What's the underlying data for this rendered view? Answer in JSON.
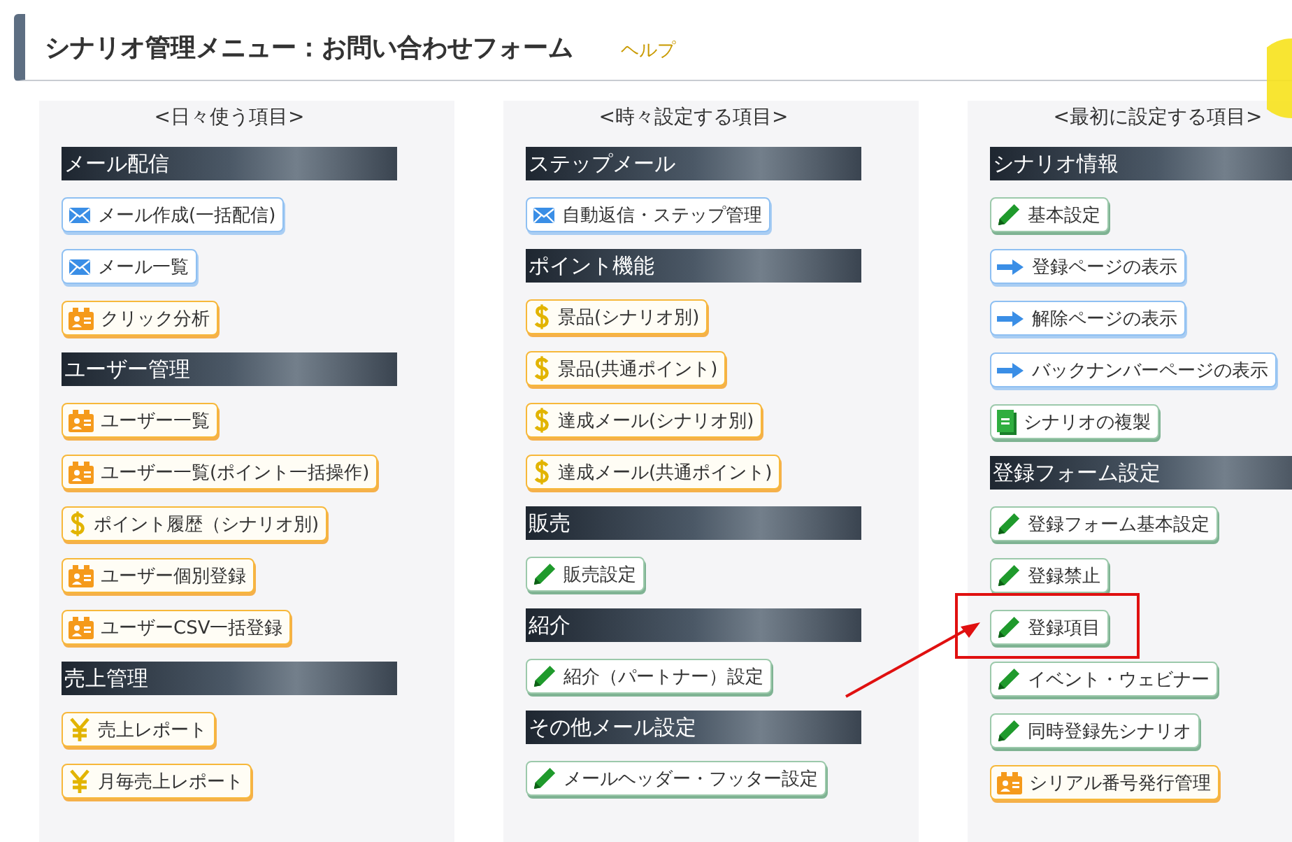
{
  "header": {
    "title": "シナリオ管理メニュー：お問い合わせフォーム",
    "help_link": "ヘルプ"
  },
  "columns": [
    {
      "heading": "<日々使う項目>",
      "sections": [
        {
          "title": "メール配信",
          "items": [
            {
              "label": "メール作成(一括配信)",
              "kind": "mail",
              "highlighted": false
            },
            {
              "label": "メール一覧",
              "kind": "mail",
              "highlighted": false
            },
            {
              "label": "クリック分析",
              "kind": "user",
              "highlighted": false
            }
          ]
        },
        {
          "title": "ユーザー管理",
          "items": [
            {
              "label": "ユーザー一覧",
              "kind": "user",
              "highlighted": false
            },
            {
              "label": "ユーザー一覧(ポイント一括操作)",
              "kind": "user",
              "highlighted": false
            },
            {
              "label": "ポイント履歴（シナリオ別)",
              "kind": "dollar",
              "highlighted": false
            },
            {
              "label": "ユーザー個別登録",
              "kind": "user",
              "highlighted": false
            },
            {
              "label": "ユーザーCSV一括登録",
              "kind": "user",
              "highlighted": false
            }
          ]
        },
        {
          "title": "売上管理",
          "items": [
            {
              "label": "売上レポート",
              "kind": "yen",
              "highlighted": false
            },
            {
              "label": "月毎売上レポート",
              "kind": "yen",
              "highlighted": false
            }
          ]
        }
      ]
    },
    {
      "heading": "<時々設定する項目>",
      "sections": [
        {
          "title": "ステップメール",
          "items": [
            {
              "label": "自動返信・ステップ管理",
              "kind": "mail",
              "highlighted": false
            }
          ]
        },
        {
          "title": "ポイント機能",
          "items": [
            {
              "label": "景品(シナリオ別)",
              "kind": "dollar",
              "highlighted": false
            },
            {
              "label": "景品(共通ポイント)",
              "kind": "dollar",
              "highlighted": false
            },
            {
              "label": "達成メール(シナリオ別)",
              "kind": "dollar",
              "highlighted": false
            },
            {
              "label": "達成メール(共通ポイント)",
              "kind": "dollar",
              "highlighted": false
            }
          ]
        },
        {
          "title": "販売",
          "items": [
            {
              "label": "販売設定",
              "kind": "pencil",
              "highlighted": false
            }
          ]
        },
        {
          "title": "紹介",
          "items": [
            {
              "label": "紹介（パートナー）設定",
              "kind": "pencil",
              "highlighted": false
            }
          ]
        },
        {
          "title": "その他メール設定",
          "items": [
            {
              "label": "メールヘッダー・フッター設定",
              "kind": "pencil",
              "highlighted": false
            }
          ]
        }
      ]
    },
    {
      "heading": "<最初に設定する項目>",
      "sections": [
        {
          "title": "シナリオ情報",
          "items": [
            {
              "label": "基本設定",
              "kind": "pencil",
              "highlighted": false
            },
            {
              "label": "登録ページの表示",
              "kind": "arrow",
              "highlighted": false
            },
            {
              "label": "解除ページの表示",
              "kind": "arrow",
              "highlighted": false
            },
            {
              "label": "バックナンバーページの表示",
              "kind": "arrow",
              "highlighted": false
            },
            {
              "label": "シナリオの複製",
              "kind": "copy",
              "highlighted": false
            }
          ]
        },
        {
          "title": "登録フォーム設定",
          "items": [
            {
              "label": "登録フォーム基本設定",
              "kind": "pencil",
              "highlighted": false
            },
            {
              "label": "登録禁止",
              "kind": "pencil",
              "highlighted": false
            },
            {
              "label": "登録項目",
              "kind": "pencil",
              "highlighted": true
            },
            {
              "label": "イベント・ウェビナー",
              "kind": "pencil",
              "highlighted": false
            },
            {
              "label": "同時登録先シナリオ",
              "kind": "pencil",
              "highlighted": false
            },
            {
              "label": "シリアル番号発行管理",
              "kind": "user",
              "highlighted": false
            }
          ]
        }
      ]
    }
  ]
}
